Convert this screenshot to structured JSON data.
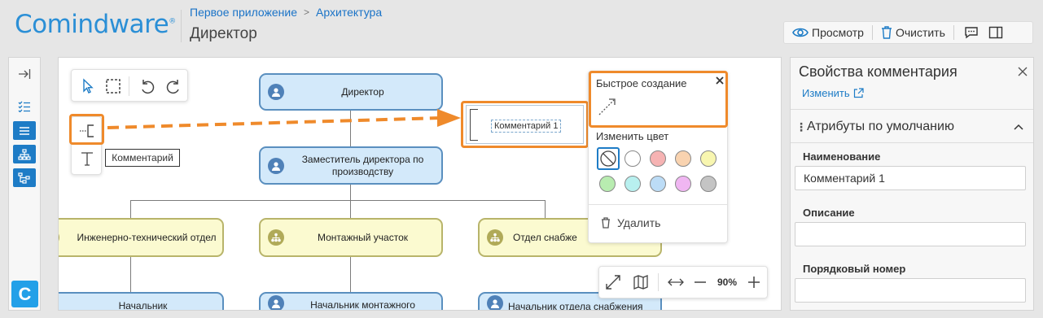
{
  "header": {
    "logo_text": "Comindware",
    "logo_reg": "®",
    "breadcrumb": [
      "Первое приложение",
      "Архитектура"
    ],
    "title": "Директор",
    "toolbar": {
      "view_label": "Просмотр",
      "clear_label": "Очистить"
    }
  },
  "canvas": {
    "nodes": {
      "director": "Директор",
      "deputy": "Заместитель директора по производству",
      "engineering": "Инженерно-технический отдел",
      "assembly": "Монтажный участок",
      "supply": "Отдел снабже",
      "head_left": "Начальник",
      "head_assembly": "Начальник монтажного",
      "head_supply": "Начальник отдела снабжения"
    },
    "comment_text": "Комментарий 1",
    "tooltip": "Комментарий",
    "quick_panel": {
      "title": "Быстрое создание",
      "change_color": "Изменить цвет",
      "delete_label": "Удалить",
      "swatches": [
        "none",
        "#ffffff",
        "#f6b3b3",
        "#f9d3b0",
        "#f8f6b0",
        "#b8ecb0",
        "#b8f0ef",
        "#bcdcf6",
        "#f0b6f2",
        "#c4c4c4"
      ]
    },
    "zoom": "90%"
  },
  "properties": {
    "title": "Свойства комментария",
    "edit_link": "Изменить",
    "section": "Атрибуты по умолчанию",
    "fields": {
      "name_label": "Наименование",
      "name_value": "Комментарий 1",
      "description_label": "Описание",
      "description_value": "",
      "order_label": "Порядковый номер",
      "order_value": ""
    }
  },
  "colors": {
    "accent": "#1e7cc6",
    "highlight": "#ef8a2b",
    "node_blue": "#d3e9fa",
    "node_yellow": "#fbfad0"
  }
}
